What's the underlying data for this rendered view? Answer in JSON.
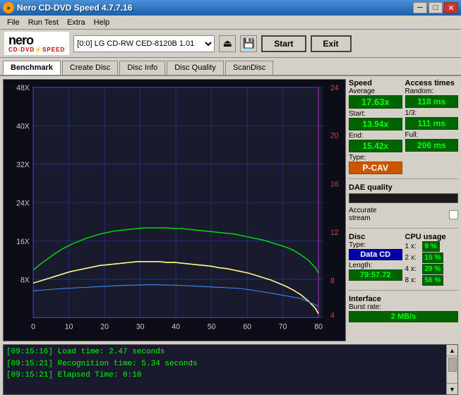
{
  "window": {
    "title": "Nero CD-DVD Speed 4.7.7.16",
    "icon": "●"
  },
  "titleControls": {
    "minimize": "─",
    "maximize": "□",
    "close": "✕"
  },
  "menu": {
    "items": [
      "File",
      "Run Test",
      "Extra",
      "Help"
    ]
  },
  "toolbar": {
    "drive": "[0:0]  LG CD-RW CED-8120B 1.01",
    "startLabel": "Start",
    "exitLabel": "Exit"
  },
  "tabs": [
    {
      "label": "Benchmark",
      "active": true
    },
    {
      "label": "Create Disc",
      "active": false
    },
    {
      "label": "Disc Info",
      "active": false
    },
    {
      "label": "Disc Quality",
      "active": false
    },
    {
      "label": "ScanDisc",
      "active": false
    }
  ],
  "chart": {
    "yMax": 24,
    "yLabelsLeft": [
      "48X",
      "40X",
      "32X",
      "24X",
      "16X",
      "8X"
    ],
    "yLabelsRight": [
      "24",
      "20",
      "16",
      "12",
      "8",
      "4"
    ],
    "xLabels": [
      "0",
      "10",
      "20",
      "30",
      "40",
      "50",
      "60",
      "70",
      "80"
    ]
  },
  "speed": {
    "title": "Speed",
    "average": {
      "label": "Average",
      "value": "17.63x"
    },
    "start": {
      "label": "Start:",
      "value": "13.94x"
    },
    "end": {
      "label": "End:",
      "value": "15.42x"
    },
    "type": {
      "label": "Type:",
      "value": "P-CAV"
    }
  },
  "access": {
    "title": "Access times",
    "random": {
      "label": "Random:",
      "value": "118 ms"
    },
    "oneThird": {
      "label": "1/3:",
      "value": "111 ms"
    },
    "full": {
      "label": "Full:",
      "value": "206 ms"
    }
  },
  "dae": {
    "title": "DAE quality",
    "bar": "",
    "accurateStreamLabel": "Accurate\nstream",
    "checkbox": false
  },
  "disc": {
    "title": "Disc",
    "typeLabel": "Type:",
    "typeValue": "Data CD",
    "lengthLabel": "Length:",
    "lengthValue": "79:57.72"
  },
  "cpu": {
    "title": "CPU usage",
    "items": [
      {
        "label": "1 x:",
        "value": "9 %"
      },
      {
        "label": "2 x:",
        "value": "15 %"
      },
      {
        "label": "4 x:",
        "value": "29 %"
      },
      {
        "label": "8 x:",
        "value": "56 %"
      }
    ]
  },
  "interface": {
    "title": "Interface",
    "burstRateLabel": "Burst rate:",
    "burstRateValue": "2 MB/s"
  },
  "log": {
    "entries": [
      "[09:15:16]  Load time: 2.47 seconds",
      "[09:15:21]  Recognition time: 5.34 seconds",
      "[09:15:21]  Elapsed Time: 0:10"
    ]
  }
}
